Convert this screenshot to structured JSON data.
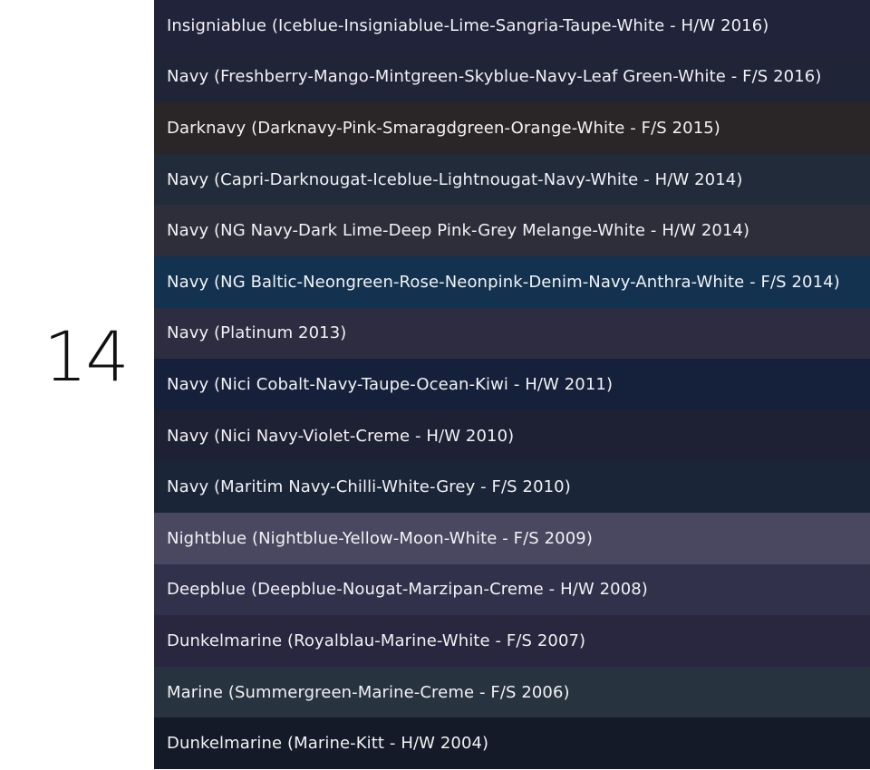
{
  "count": "14",
  "items": [
    {
      "label": "Insigniablue (Iceblue-Insigniablue-Lime-Sangria-Taupe-White - H/W 2016)",
      "color": "#20233a"
    },
    {
      "label": "Navy (Freshberry-Mango-Mintgreen-Skyblue-Navy-Leaf Green-White - F/S 2016)",
      "color": "#1f2437"
    },
    {
      "label": "Darknavy (Darknavy-Pink-Smaragdgreen-Orange-White - F/S 2015)",
      "color": "#2a2628"
    },
    {
      "label": "Navy (Capri-Darknougat-Iceblue-Lightnougat-Navy-White - H/W 2014)",
      "color": "#222b39"
    },
    {
      "label": "Navy (NG Navy-Dark Lime-Deep Pink-Grey Melange-White - H/W 2014)",
      "color": "#2e2d3a"
    },
    {
      "label": "Navy (NG Baltic-Neongreen-Rose-Neonpink-Denim-Navy-Anthra-White -  F/S 2014)",
      "color": "#13324f"
    },
    {
      "label": "Navy (Platinum 2013)",
      "color": "#2e2c40"
    },
    {
      "label": "Navy (Nici Cobalt-Navy-Taupe-Ocean-Kiwi - H/W 2011)",
      "color": "#15213a"
    },
    {
      "label": "Navy (Nici Navy-Violet-Creme - H/W 2010)",
      "color": "#1e2133"
    },
    {
      "label": "Navy (Maritim Navy-Chilli-White-Grey - F/S 2010)",
      "color": "#1a2538"
    },
    {
      "label": "Nightblue (Nightblue-Yellow-Moon-White - F/S 2009)",
      "color": "#4a4860"
    },
    {
      "label": "Deepblue (Deepblue-Nougat-Marzipan-Creme - H/W 2008)",
      "color": "#32314b"
    },
    {
      "label": "Dunkelmarine (Royalblau-Marine-White - F/S 2007)",
      "color": "#28273f"
    },
    {
      "label": "Marine (Summergreen-Marine-Creme - F/S 2006)",
      "color": "#283340"
    },
    {
      "label": "Dunkelmarine (Marine-Kitt - H/W 2004)",
      "color": "#141a28"
    }
  ]
}
